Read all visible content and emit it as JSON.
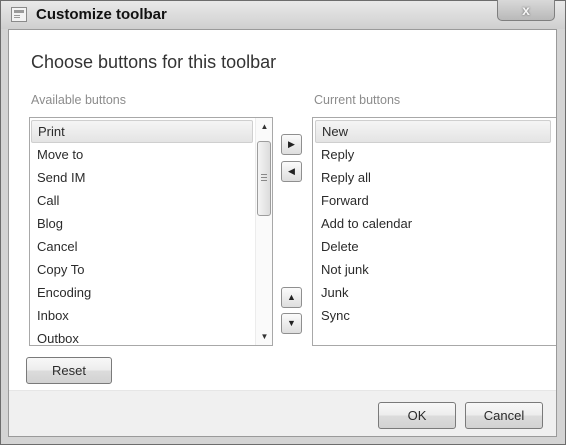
{
  "window": {
    "title": "Customize toolbar",
    "close_label": "x"
  },
  "dialog": {
    "heading": "Choose buttons for this toolbar",
    "available_label": "Available buttons",
    "current_label": "Current buttons",
    "available_items": [
      "Print",
      "Move to",
      "Send IM",
      "Call",
      "Blog",
      "Cancel",
      "Copy To",
      "Encoding",
      "Inbox",
      "Outbox"
    ],
    "available_selected": "Print",
    "current_items": [
      "New",
      "Reply",
      "Reply all",
      "Forward",
      "Add to calendar",
      "Delete",
      "Not junk",
      "Junk",
      "Sync"
    ],
    "current_selected": "New",
    "reset_label": "Reset",
    "ok_label": "OK",
    "cancel_label": "Cancel"
  },
  "icons": {
    "add": "triangle-right",
    "remove": "triangle-left",
    "move_up": "triangle-up",
    "move_down": "triangle-down"
  }
}
